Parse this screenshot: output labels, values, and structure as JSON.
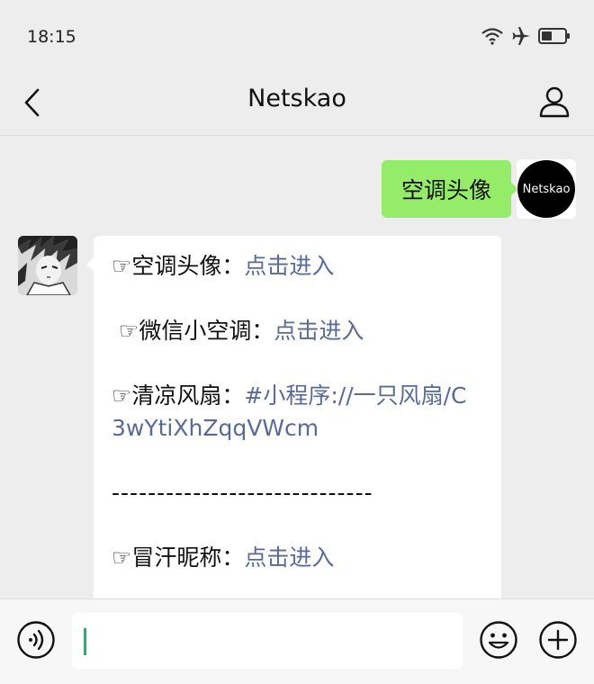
{
  "status": {
    "time": "18:15"
  },
  "nav": {
    "title": "Netskao"
  },
  "outgoing": {
    "text": "空调头像",
    "avatar_text": "Netskao"
  },
  "incoming": {
    "lines": [
      {
        "prefix": "☞空调头像：",
        "link": "点击进入"
      },
      {
        "prefix": " ☞微信小空调：",
        "link": "点击进入"
      },
      {
        "prefix": "☞清凉风扇：",
        "link": "#小程序://一只风扇/C3wYtiXhZqqVWcm"
      },
      {
        "separator": "-----------------------------"
      },
      {
        "prefix": "☞冒汗昵称：",
        "link": "点击进入"
      }
    ]
  },
  "icons": {
    "wifi": "wifi-icon",
    "airplane": "airplane-icon",
    "battery": "battery-icon",
    "back": "back-chevron-icon",
    "profile": "profile-icon",
    "voice": "voice-icon",
    "emoji": "emoji-icon",
    "plus": "plus-icon"
  },
  "colors": {
    "bubble_out": "#95ec69",
    "link": "#576b95",
    "caret": "#07c160",
    "background": "#ededed"
  }
}
